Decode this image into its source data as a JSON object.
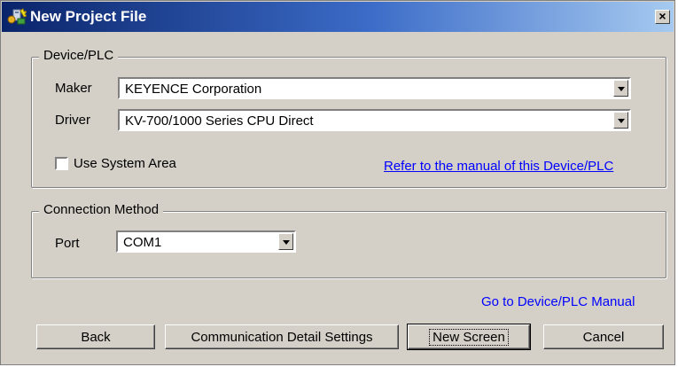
{
  "window": {
    "title": "New Project File",
    "close_label": "×"
  },
  "device_plc": {
    "legend": "Device/PLC",
    "maker_label": "Maker",
    "maker_value": "KEYENCE Corporation",
    "driver_label": "Driver",
    "driver_value": "KV-700/1000 Series CPU Direct",
    "use_system_area_label": "Use System Area",
    "use_system_area_checked": false,
    "manual_link": "Refer to the manual of this Device/PLC"
  },
  "connection": {
    "legend": "Connection Method",
    "port_label": "Port",
    "port_value": "COM1"
  },
  "goto_manual_link": "Go to Device/PLC Manual",
  "buttons": {
    "back": "Back",
    "comm_settings": "Communication Detail Settings",
    "new_screen": "New Screen",
    "cancel": "Cancel"
  },
  "colors": {
    "title_start": "#0a246a",
    "title_end": "#a6caf0",
    "link": "#0000ff",
    "face": "#d4d0c8"
  }
}
